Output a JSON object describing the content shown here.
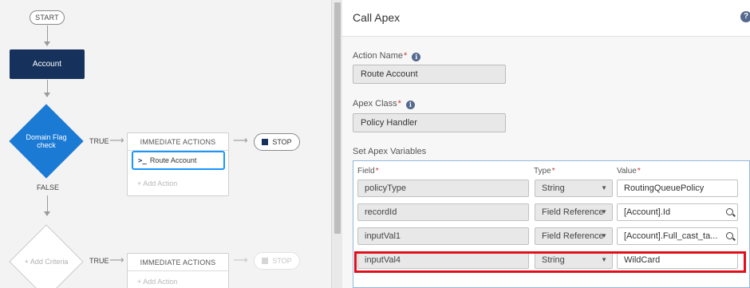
{
  "canvas": {
    "start_label": "START",
    "object_node_label": "Account",
    "decision_label": "Domain Flag check",
    "true_label": "TRUE",
    "false_label": "FALSE",
    "add_criteria_label": "+ Add Criteria",
    "immediate_actions_label": "IMMEDIATE ACTIONS",
    "action_item_label": "Route Account",
    "add_action_label": "+ Add Action",
    "stop_label": "STOP"
  },
  "panel": {
    "title": "Call Apex",
    "help_icon": "?",
    "action_name_label": "Action Name",
    "action_name_value": "Route Account",
    "apex_class_label": "Apex Class",
    "apex_class_value": "Policy Handler",
    "set_vars_label": "Set Apex Variables",
    "required_marker": "*",
    "info_icon": "i",
    "columns": {
      "field": "Field",
      "type": "Type",
      "value": "Value"
    },
    "rows": [
      {
        "field": "policyType",
        "type": "String",
        "value": "RoutingQueuePolicy",
        "value_kind": "text"
      },
      {
        "field": "recordId",
        "type": "Field Reference",
        "value": "[Account].Id",
        "value_kind": "lookup"
      },
      {
        "field": "inputVal1",
        "type": "Field Reference",
        "value": "[Account].Full_cast_ta...",
        "value_kind": "lookup"
      },
      {
        "field": "inputVal4",
        "type": "String",
        "value": "WildCard",
        "value_kind": "text"
      }
    ]
  },
  "colors": {
    "navy": "#16325c",
    "decision_blue": "#1b7ad4",
    "selection_blue": "#1b96ff",
    "highlight_red": "#e0101b"
  }
}
